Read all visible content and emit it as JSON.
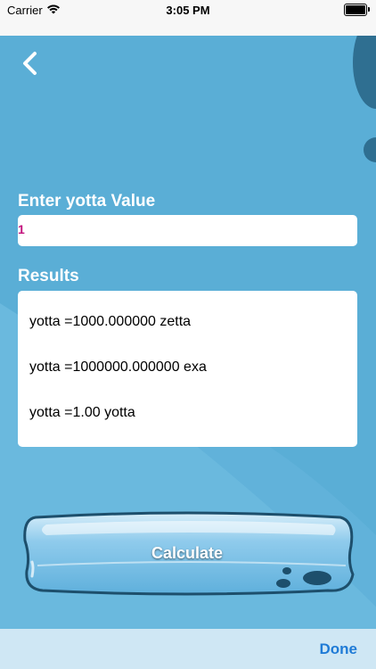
{
  "status_bar": {
    "carrier": "Carrier",
    "time": "3:05 PM",
    "wifi_icon": "wifi-icon",
    "battery_icon": "battery-icon",
    "battery_level": 1.0
  },
  "nav": {
    "back_icon": "chevron-left-icon"
  },
  "input_section": {
    "label": "Enter yotta Value",
    "value": "1",
    "value_color": "#c2137d"
  },
  "results_section": {
    "label": "Results",
    "lines": [
      "yotta =1000.000000 zetta",
      "yotta =1000000.000000 exa",
      "yotta =1.00 yotta"
    ]
  },
  "calculate_button": {
    "label": "Calculate"
  },
  "keyboard_toolbar": {
    "done_label": "Done",
    "done_color": "#1f7bd6"
  },
  "colors": {
    "background": "#5aaed6",
    "card": "#ffffff",
    "text_white": "#ffffff"
  }
}
